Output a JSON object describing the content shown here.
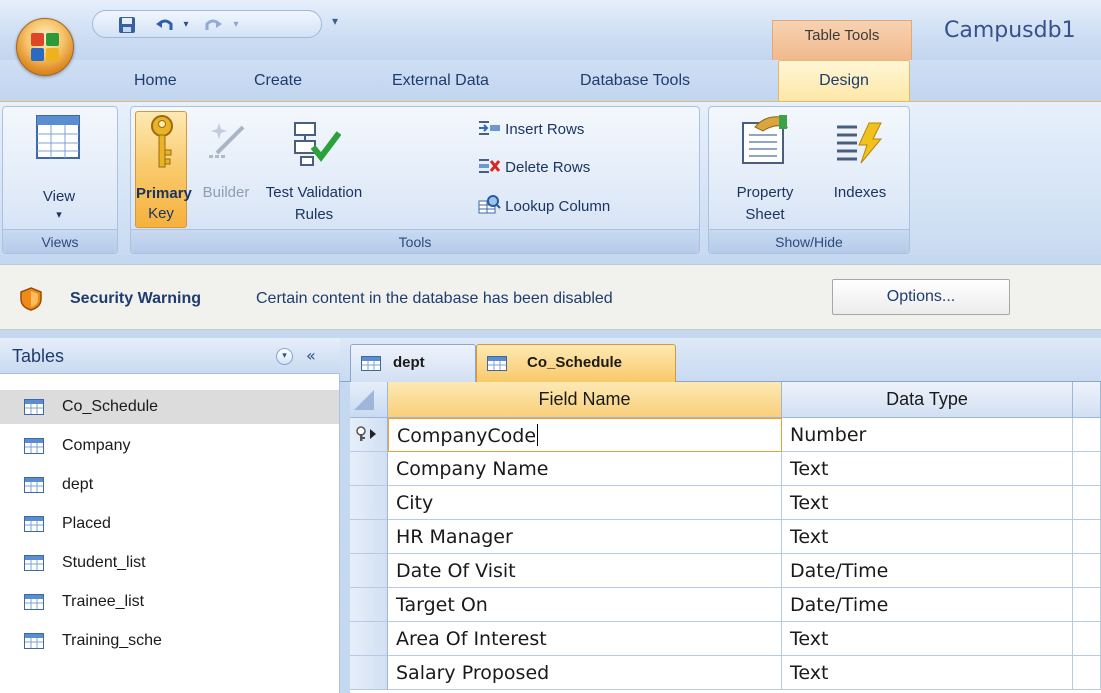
{
  "window": {
    "title": "Campusdb1",
    "context_group": "Table Tools"
  },
  "qat": {
    "icons": [
      "save-icon",
      "undo-icon",
      "redo-icon",
      "customize-icon"
    ],
    "customize_glyph": "▾"
  },
  "tabs": [
    {
      "label": "Home"
    },
    {
      "label": "Create"
    },
    {
      "label": "External Data"
    },
    {
      "label": "Database Tools"
    },
    {
      "label": "Design",
      "active": true
    }
  ],
  "ribbon": {
    "groups": {
      "views": {
        "label": "Views",
        "view": {
          "label": "View",
          "arrow": "▾"
        }
      },
      "tools": {
        "label": "Tools",
        "primary_key": {
          "label_line1": "Primary",
          "label_line2": "Key"
        },
        "builder": {
          "label": "Builder"
        },
        "test_validation": {
          "label_line1": "Test Validation",
          "label_line2": "Rules"
        },
        "insert_rows": {
          "label": "Insert Rows"
        },
        "delete_rows": {
          "label": "Delete Rows"
        },
        "lookup_column": {
          "label": "Lookup Column"
        }
      },
      "show_hide": {
        "label": "Show/Hide",
        "property_sheet": {
          "label_line1": "Property",
          "label_line2": "Sheet"
        },
        "indexes": {
          "label": "Indexes"
        }
      }
    }
  },
  "security": {
    "title": "Security Warning",
    "message": "Certain content in the database has been disabled",
    "options_label": "Options..."
  },
  "nav": {
    "title": "Tables",
    "collapse_glyph": "«",
    "dropdown_glyph": "▾",
    "items": [
      {
        "label": "Co_Schedule",
        "selected": true
      },
      {
        "label": "Company"
      },
      {
        "label": "dept"
      },
      {
        "label": "Placed"
      },
      {
        "label": "Student_list"
      },
      {
        "label": "Trainee_list"
      },
      {
        "label": "Training_sche"
      }
    ]
  },
  "doc_tabs": [
    {
      "label": "dept"
    },
    {
      "label": "Co_Schedule",
      "active": true
    }
  ],
  "grid": {
    "columns": {
      "field_name": "Field Name",
      "data_type": "Data Type"
    },
    "pk_glyph": "🔑▸",
    "rows": [
      {
        "field": "CompanyCode",
        "type": "Number",
        "primary_key": true
      },
      {
        "field": "Company Name",
        "type": "Text"
      },
      {
        "field": "City",
        "type": "Text"
      },
      {
        "field": "HR Manager",
        "type": "Text"
      },
      {
        "field": "Date Of Visit",
        "type": "Date/Time"
      },
      {
        "field": "Target On",
        "type": "Date/Time"
      },
      {
        "field": "Area Of Interest",
        "type": "Text"
      },
      {
        "field": "Salary Proposed",
        "type": "Text"
      }
    ]
  },
  "colors": {
    "accent_orange": "#f9c96a",
    "ribbon_blue": "#c9daf1",
    "title_blue": "#37518a"
  }
}
